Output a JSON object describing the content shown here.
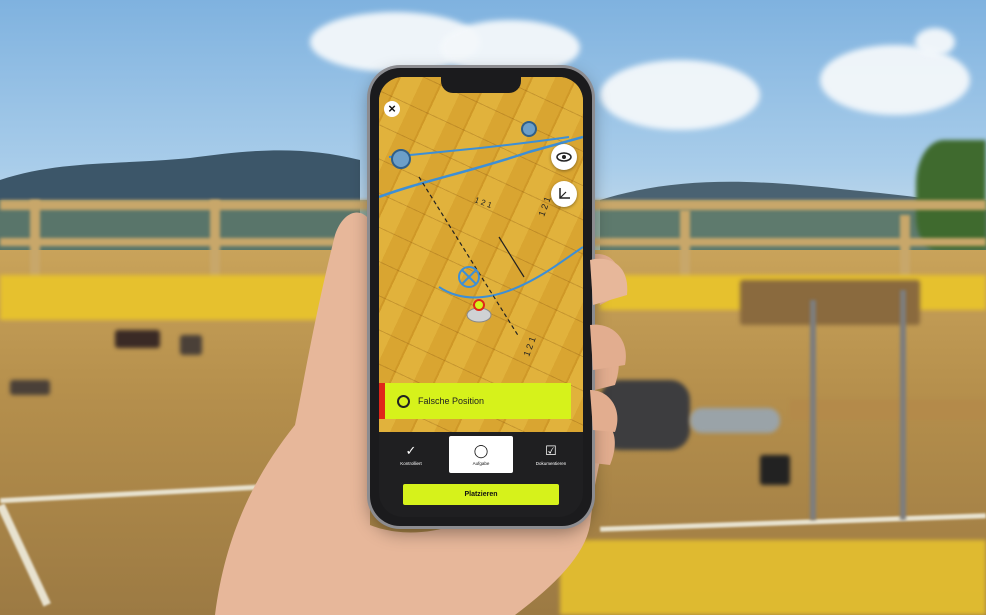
{
  "scene": {
    "description_free": true
  },
  "app": {
    "close_icon": "close-icon",
    "view_toggle_icon": "eye-icon",
    "coordinate_icon": "axes-icon",
    "status": {
      "text": "Falsche Position",
      "accent_color": "#d6f21b",
      "error_color": "#e0261a"
    },
    "tabs": [
      {
        "label": "Kontrolliert",
        "icon": "check-icon",
        "active": false
      },
      {
        "label": "Aufgabe",
        "icon": "circle-icon",
        "active": true
      },
      {
        "label": "Dokumentieren",
        "icon": "edit-icon",
        "active": false
      }
    ],
    "cta_label": "Platzieren",
    "plan_labels": [
      "1 2 1",
      "1 2 1",
      "1 2 1"
    ]
  }
}
